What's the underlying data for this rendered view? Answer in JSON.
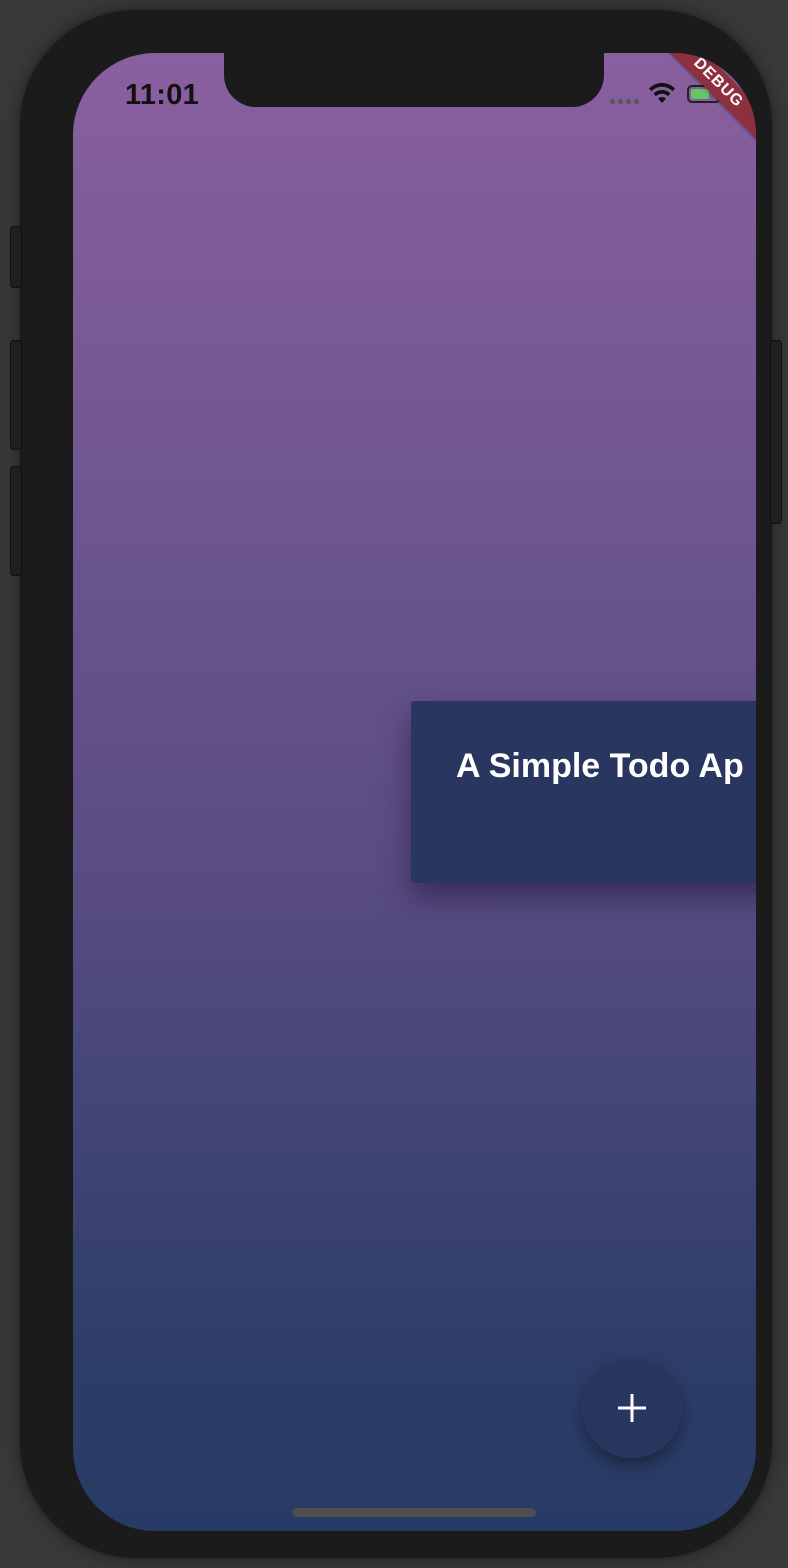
{
  "status_bar": {
    "time": "11:01"
  },
  "debug_banner": {
    "label": "DEBUG"
  },
  "main": {
    "title": "A Simple Todo Ap"
  },
  "fab": {
    "icon": "plus-icon"
  },
  "colors": {
    "gradient_top": "#8a5fa0",
    "gradient_bottom": "#283b66",
    "card": "#293760",
    "debug": "#8e2f3e"
  }
}
